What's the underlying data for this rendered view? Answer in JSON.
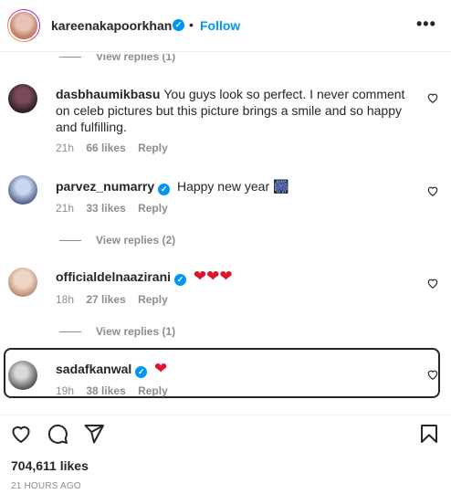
{
  "header": {
    "username": "kareenakapoorkhan",
    "verified_icon": "verified-badge-icon",
    "separator": "•",
    "follow_label": "Follow",
    "more_label": "•••"
  },
  "comments": [
    {
      "username": "dasbhaumikbasu",
      "verified": false,
      "text": "You guys look so perfect. I never comment on celeb pictures but this picture brings a smile and so happy and fulfilling.",
      "time": "21h",
      "likes": "66 likes",
      "reply": "Reply"
    },
    {
      "username": "parvez_numarry",
      "verified": true,
      "text": "Happy new year",
      "emoji": "🎆",
      "time": "21h",
      "likes": "33 likes",
      "reply": "Reply",
      "view_replies": "View replies (2)"
    },
    {
      "username": "officialdelnaazirani",
      "verified": true,
      "text": "❤❤❤",
      "time": "18h",
      "likes": "27 likes",
      "reply": "Reply",
      "view_replies": "View replies (1)"
    },
    {
      "username": "sadafkanwal",
      "verified": true,
      "text": "❤",
      "time": "19h",
      "likes": "38 likes",
      "reply": "Reply"
    }
  ],
  "top_view_replies": "View replies (1)",
  "post": {
    "likes": "704,611 likes",
    "time_ago": "21 HOURS AGO"
  },
  "icons": [
    "heart-icon",
    "comment-icon",
    "share-icon",
    "bookmark-icon"
  ],
  "colors": {
    "accent": "#0095f6",
    "heart": "#e0142b",
    "muted": "#8e8e8e"
  }
}
